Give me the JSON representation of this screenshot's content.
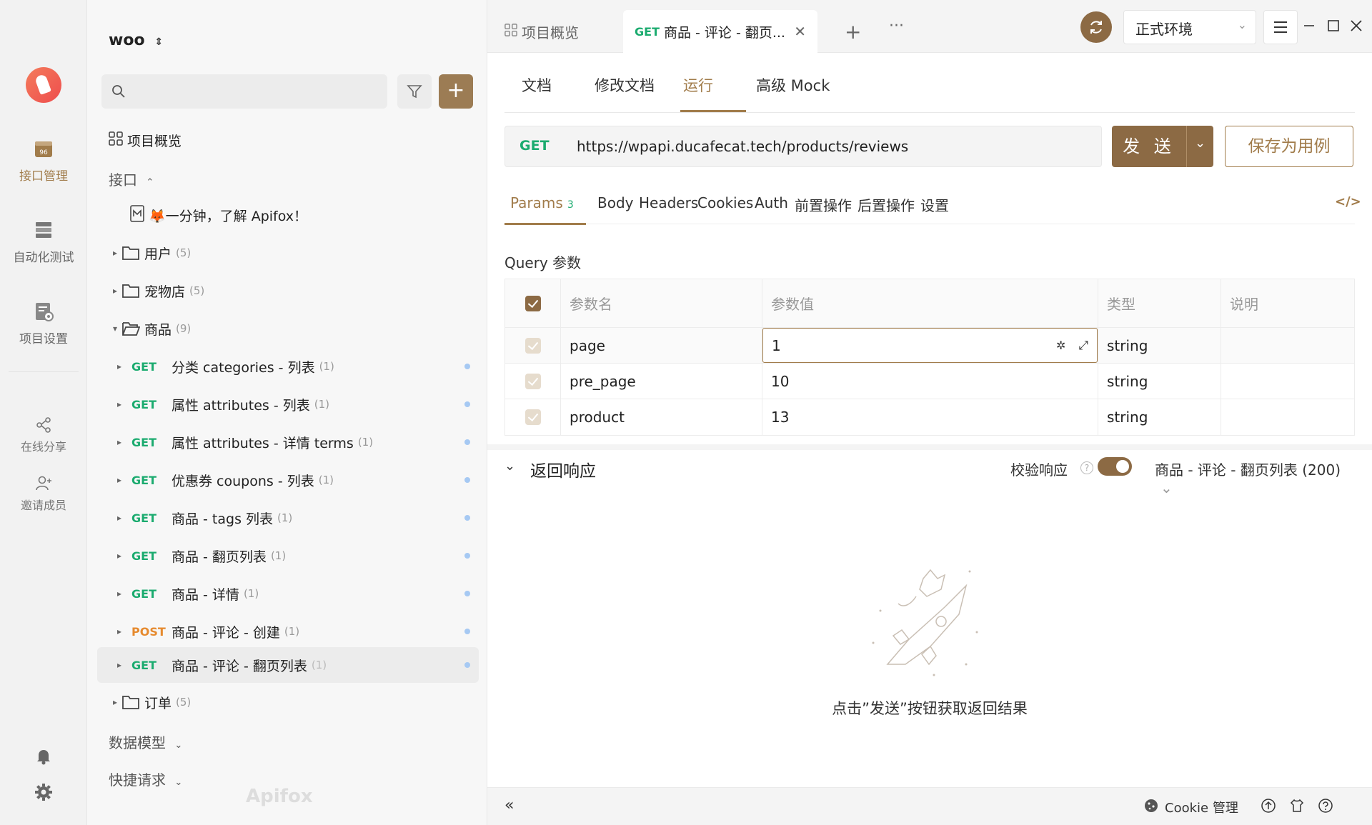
{
  "nav_rail": {
    "items": [
      {
        "label": "接口管理",
        "icon": "api-folder-icon",
        "active": true
      },
      {
        "label": "自动化测试",
        "icon": "test-stack-icon"
      },
      {
        "label": "项目设置",
        "icon": "settings-doc-icon"
      }
    ],
    "share_label": "在线分享",
    "invite_label": "邀请成员"
  },
  "sidebar": {
    "project_name": "woo",
    "overview_label": "项目概览",
    "api_section_label": "接口",
    "intro_item": "🦊一分钟，了解 Apifox！",
    "folders_top": [
      {
        "name": "用户",
        "count": "(5)"
      },
      {
        "name": "宠物店",
        "count": "(5)"
      }
    ],
    "open_folder": {
      "name": "商品",
      "count": "(9)"
    },
    "endpoints": [
      {
        "method": "GET",
        "name": "分类 categories - 列表",
        "count": "(1)"
      },
      {
        "method": "GET",
        "name": "属性 attributes - 列表",
        "count": "(1)"
      },
      {
        "method": "GET",
        "name": "属性 attributes - 详情 terms",
        "count": "(1)"
      },
      {
        "method": "GET",
        "name": "优惠券 coupons - 列表",
        "count": "(1)"
      },
      {
        "method": "GET",
        "name": "商品 - tags 列表",
        "count": "(1)"
      },
      {
        "method": "GET",
        "name": "商品 - 翻页列表",
        "count": "(1)"
      },
      {
        "method": "GET",
        "name": "商品 - 详情",
        "count": "(1)"
      },
      {
        "method": "POST",
        "name": "商品 - 评论 - 创建",
        "count": "(1)"
      },
      {
        "method": "GET",
        "name": "商品 - 评论 - 翻页列表",
        "count": "(1)",
        "selected": true
      }
    ],
    "folder_bottom": {
      "name": "订单",
      "count": "(5)"
    },
    "data_model_label": "数据模型",
    "quick_request_label": "快捷请求",
    "brand": "Apifox"
  },
  "tabs": {
    "overview": "项目概览",
    "active_method": "GET",
    "active_title": "商品 - 评论 - 翻页..."
  },
  "env": {
    "selected": "正式环境"
  },
  "subtabs": [
    "文档",
    "修改文档",
    "运行",
    "高级 Mock"
  ],
  "request": {
    "method": "GET",
    "url": "https://wpapi.ducafecat.tech/products/reviews",
    "send_label": "发 送",
    "save_label": "保存为用例"
  },
  "param_tabs": {
    "params": "Params",
    "params_count": "3",
    "others": [
      "Body",
      "Headers",
      "Cookies",
      "Auth",
      "前置操作",
      "后置操作",
      "设置"
    ]
  },
  "query": {
    "title": "Query 参数",
    "headers": [
      "参数名",
      "参数值",
      "类型",
      "说明"
    ],
    "rows": [
      {
        "name": "page",
        "value": "1",
        "type": "string"
      },
      {
        "name": "pre_page",
        "value": "10",
        "type": "string"
      },
      {
        "name": "product",
        "value": "13",
        "type": "string"
      }
    ]
  },
  "response": {
    "title": "返回响应",
    "verify_label": "校验响应",
    "case_label": "商品 - 评论 - 翻页列表 (200)",
    "empty_text": "点击”发送”按钮获取返回结果"
  },
  "statusbar": {
    "cookie_label": "Cookie 管理"
  },
  "colors": {
    "accent": "#8c6a44",
    "get": "#1bab6f",
    "post": "#e68a2e"
  }
}
